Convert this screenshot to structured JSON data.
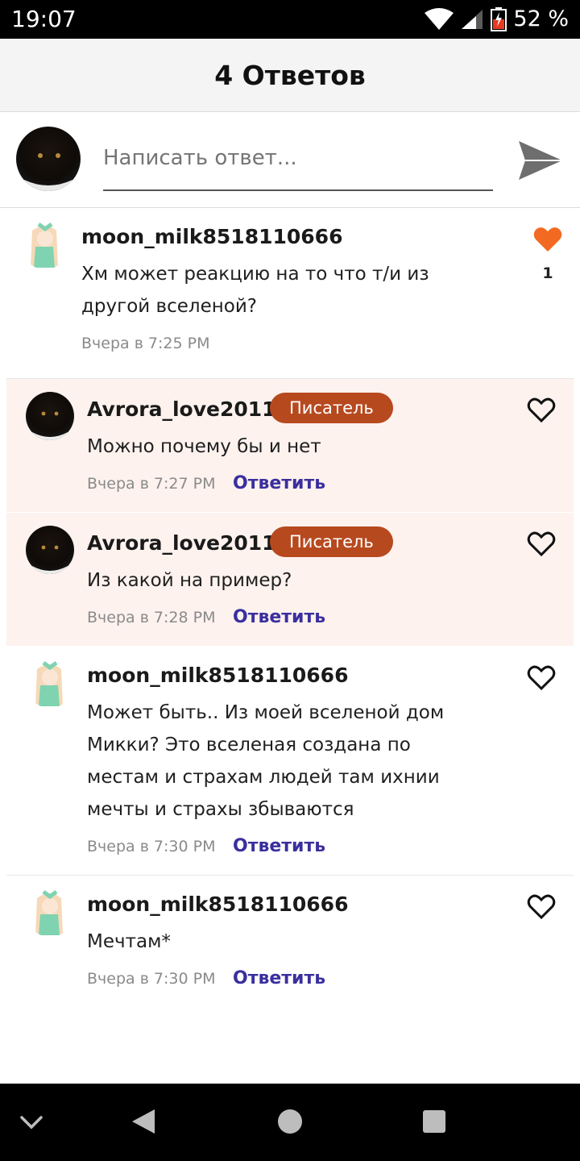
{
  "status": {
    "time": "19:07",
    "battery": "52 %"
  },
  "header": {
    "title": "4 Ответов"
  },
  "composer": {
    "placeholder": "Написать ответ..."
  },
  "main_comment": {
    "author": "moon_milk8518110666",
    "text_line1": "Хм может реакцию на то что т/и из",
    "text_line2": "другой вселеной?",
    "time": "Вчера в 7:25 PM",
    "likes": "1"
  },
  "replies": [
    {
      "author": "Avrora_love2011",
      "badge": "Писатель",
      "text": "Можно почему бы и нет",
      "time": "Вчера в 7:27 PM",
      "reply_label": "Ответить"
    },
    {
      "author": "Avrora_love2011",
      "badge": "Писатель",
      "text": "Из какой на пример?",
      "time": "Вчера в 7:28 PM",
      "reply_label": "Ответить"
    },
    {
      "author": "moon_milk8518110666",
      "text_line1": "Может быть.. Из моей вселеной дом",
      "text_line2": "Микки? Это вселеная создана по",
      "text_line3": "местам и страхам людей там ихнии",
      "text_line4": "мечты  и страхы збываются",
      "time": "Вчера в 7:30 PM",
      "reply_label": "Ответить"
    },
    {
      "author": "moon_milk8518110666",
      "text": "Мечтам*",
      "time": "Вчера в 7:30 PM",
      "reply_label": "Ответить"
    }
  ],
  "colors": {
    "accent_heart": "#f26a21",
    "badge": "#b7491f",
    "reply_link": "#3a2f9e",
    "tint": "#fdf2ee"
  },
  "icons": {
    "wifi": "wifi-icon",
    "signal": "signal-icon",
    "battery": "battery-icon",
    "send": "send-icon",
    "heart_filled": "heart-filled-icon",
    "heart_outline": "heart-outline-icon",
    "nav_collapse": "chevron-down-icon",
    "nav_back": "back-triangle-icon",
    "nav_home": "home-circle-icon",
    "nav_recents": "recents-square-icon"
  }
}
